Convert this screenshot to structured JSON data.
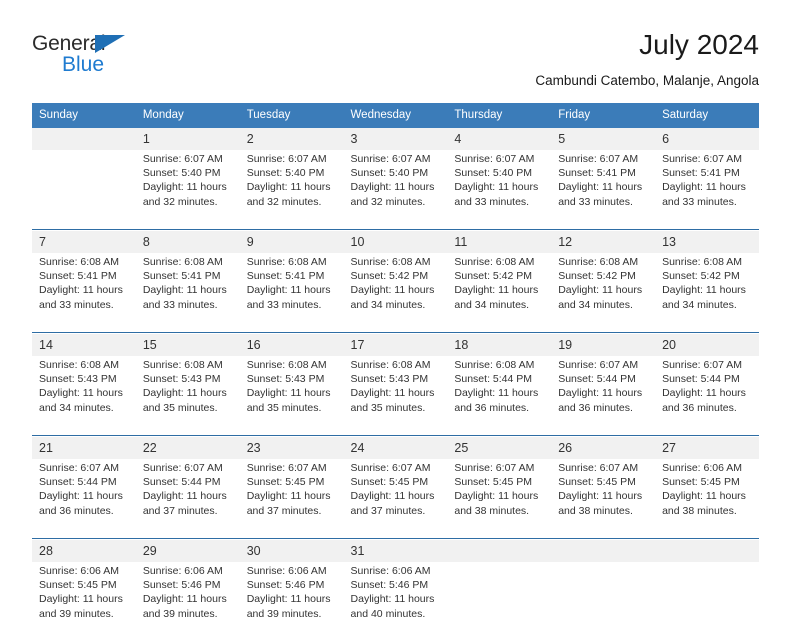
{
  "brand": {
    "name_part1": "General",
    "name_part2": "Blue",
    "logo_icon": "triangle-icon",
    "accent_color": "#1f7bd0",
    "dark_color": "#2b2b2b"
  },
  "header": {
    "title": "July 2024",
    "subtitle": "Cambundi Catembo, Malanje, Angola"
  },
  "theme": {
    "header_bar_color": "#3b7cb9",
    "row_separator_color": "#2e6da4",
    "daynum_band_color": "#f1f1f1",
    "text_color": "#333333"
  },
  "calendar": {
    "weekday_headers": [
      "Sunday",
      "Monday",
      "Tuesday",
      "Wednesday",
      "Thursday",
      "Friday",
      "Saturday"
    ],
    "weeks": [
      [
        {
          "day": "",
          "sunrise": "",
          "sunset": "",
          "daylight_line1": "",
          "daylight_line2": ""
        },
        {
          "day": "1",
          "sunrise": "Sunrise: 6:07 AM",
          "sunset": "Sunset: 5:40 PM",
          "daylight_line1": "Daylight: 11 hours",
          "daylight_line2": "and 32 minutes."
        },
        {
          "day": "2",
          "sunrise": "Sunrise: 6:07 AM",
          "sunset": "Sunset: 5:40 PM",
          "daylight_line1": "Daylight: 11 hours",
          "daylight_line2": "and 32 minutes."
        },
        {
          "day": "3",
          "sunrise": "Sunrise: 6:07 AM",
          "sunset": "Sunset: 5:40 PM",
          "daylight_line1": "Daylight: 11 hours",
          "daylight_line2": "and 32 minutes."
        },
        {
          "day": "4",
          "sunrise": "Sunrise: 6:07 AM",
          "sunset": "Sunset: 5:40 PM",
          "daylight_line1": "Daylight: 11 hours",
          "daylight_line2": "and 33 minutes."
        },
        {
          "day": "5",
          "sunrise": "Sunrise: 6:07 AM",
          "sunset": "Sunset: 5:41 PM",
          "daylight_line1": "Daylight: 11 hours",
          "daylight_line2": "and 33 minutes."
        },
        {
          "day": "6",
          "sunrise": "Sunrise: 6:07 AM",
          "sunset": "Sunset: 5:41 PM",
          "daylight_line1": "Daylight: 11 hours",
          "daylight_line2": "and 33 minutes."
        }
      ],
      [
        {
          "day": "7",
          "sunrise": "Sunrise: 6:08 AM",
          "sunset": "Sunset: 5:41 PM",
          "daylight_line1": "Daylight: 11 hours",
          "daylight_line2": "and 33 minutes."
        },
        {
          "day": "8",
          "sunrise": "Sunrise: 6:08 AM",
          "sunset": "Sunset: 5:41 PM",
          "daylight_line1": "Daylight: 11 hours",
          "daylight_line2": "and 33 minutes."
        },
        {
          "day": "9",
          "sunrise": "Sunrise: 6:08 AM",
          "sunset": "Sunset: 5:41 PM",
          "daylight_line1": "Daylight: 11 hours",
          "daylight_line2": "and 33 minutes."
        },
        {
          "day": "10",
          "sunrise": "Sunrise: 6:08 AM",
          "sunset": "Sunset: 5:42 PM",
          "daylight_line1": "Daylight: 11 hours",
          "daylight_line2": "and 34 minutes."
        },
        {
          "day": "11",
          "sunrise": "Sunrise: 6:08 AM",
          "sunset": "Sunset: 5:42 PM",
          "daylight_line1": "Daylight: 11 hours",
          "daylight_line2": "and 34 minutes."
        },
        {
          "day": "12",
          "sunrise": "Sunrise: 6:08 AM",
          "sunset": "Sunset: 5:42 PM",
          "daylight_line1": "Daylight: 11 hours",
          "daylight_line2": "and 34 minutes."
        },
        {
          "day": "13",
          "sunrise": "Sunrise: 6:08 AM",
          "sunset": "Sunset: 5:42 PM",
          "daylight_line1": "Daylight: 11 hours",
          "daylight_line2": "and 34 minutes."
        }
      ],
      [
        {
          "day": "14",
          "sunrise": "Sunrise: 6:08 AM",
          "sunset": "Sunset: 5:43 PM",
          "daylight_line1": "Daylight: 11 hours",
          "daylight_line2": "and 34 minutes."
        },
        {
          "day": "15",
          "sunrise": "Sunrise: 6:08 AM",
          "sunset": "Sunset: 5:43 PM",
          "daylight_line1": "Daylight: 11 hours",
          "daylight_line2": "and 35 minutes."
        },
        {
          "day": "16",
          "sunrise": "Sunrise: 6:08 AM",
          "sunset": "Sunset: 5:43 PM",
          "daylight_line1": "Daylight: 11 hours",
          "daylight_line2": "and 35 minutes."
        },
        {
          "day": "17",
          "sunrise": "Sunrise: 6:08 AM",
          "sunset": "Sunset: 5:43 PM",
          "daylight_line1": "Daylight: 11 hours",
          "daylight_line2": "and 35 minutes."
        },
        {
          "day": "18",
          "sunrise": "Sunrise: 6:08 AM",
          "sunset": "Sunset: 5:44 PM",
          "daylight_line1": "Daylight: 11 hours",
          "daylight_line2": "and 36 minutes."
        },
        {
          "day": "19",
          "sunrise": "Sunrise: 6:07 AM",
          "sunset": "Sunset: 5:44 PM",
          "daylight_line1": "Daylight: 11 hours",
          "daylight_line2": "and 36 minutes."
        },
        {
          "day": "20",
          "sunrise": "Sunrise: 6:07 AM",
          "sunset": "Sunset: 5:44 PM",
          "daylight_line1": "Daylight: 11 hours",
          "daylight_line2": "and 36 minutes."
        }
      ],
      [
        {
          "day": "21",
          "sunrise": "Sunrise: 6:07 AM",
          "sunset": "Sunset: 5:44 PM",
          "daylight_line1": "Daylight: 11 hours",
          "daylight_line2": "and 36 minutes."
        },
        {
          "day": "22",
          "sunrise": "Sunrise: 6:07 AM",
          "sunset": "Sunset: 5:44 PM",
          "daylight_line1": "Daylight: 11 hours",
          "daylight_line2": "and 37 minutes."
        },
        {
          "day": "23",
          "sunrise": "Sunrise: 6:07 AM",
          "sunset": "Sunset: 5:45 PM",
          "daylight_line1": "Daylight: 11 hours",
          "daylight_line2": "and 37 minutes."
        },
        {
          "day": "24",
          "sunrise": "Sunrise: 6:07 AM",
          "sunset": "Sunset: 5:45 PM",
          "daylight_line1": "Daylight: 11 hours",
          "daylight_line2": "and 37 minutes."
        },
        {
          "day": "25",
          "sunrise": "Sunrise: 6:07 AM",
          "sunset": "Sunset: 5:45 PM",
          "daylight_line1": "Daylight: 11 hours",
          "daylight_line2": "and 38 minutes."
        },
        {
          "day": "26",
          "sunrise": "Sunrise: 6:07 AM",
          "sunset": "Sunset: 5:45 PM",
          "daylight_line1": "Daylight: 11 hours",
          "daylight_line2": "and 38 minutes."
        },
        {
          "day": "27",
          "sunrise": "Sunrise: 6:06 AM",
          "sunset": "Sunset: 5:45 PM",
          "daylight_line1": "Daylight: 11 hours",
          "daylight_line2": "and 38 minutes."
        }
      ],
      [
        {
          "day": "28",
          "sunrise": "Sunrise: 6:06 AM",
          "sunset": "Sunset: 5:45 PM",
          "daylight_line1": "Daylight: 11 hours",
          "daylight_line2": "and 39 minutes."
        },
        {
          "day": "29",
          "sunrise": "Sunrise: 6:06 AM",
          "sunset": "Sunset: 5:46 PM",
          "daylight_line1": "Daylight: 11 hours",
          "daylight_line2": "and 39 minutes."
        },
        {
          "day": "30",
          "sunrise": "Sunrise: 6:06 AM",
          "sunset": "Sunset: 5:46 PM",
          "daylight_line1": "Daylight: 11 hours",
          "daylight_line2": "and 39 minutes."
        },
        {
          "day": "31",
          "sunrise": "Sunrise: 6:06 AM",
          "sunset": "Sunset: 5:46 PM",
          "daylight_line1": "Daylight: 11 hours",
          "daylight_line2": "and 40 minutes."
        },
        {
          "day": "",
          "sunrise": "",
          "sunset": "",
          "daylight_line1": "",
          "daylight_line2": ""
        },
        {
          "day": "",
          "sunrise": "",
          "sunset": "",
          "daylight_line1": "",
          "daylight_line2": ""
        },
        {
          "day": "",
          "sunrise": "",
          "sunset": "",
          "daylight_line1": "",
          "daylight_line2": ""
        }
      ]
    ]
  }
}
